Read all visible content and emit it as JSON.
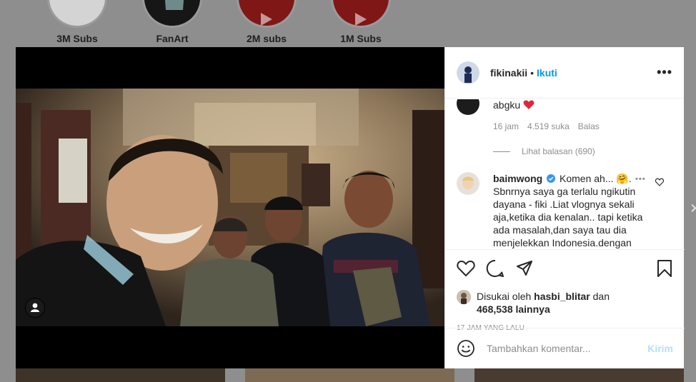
{
  "highlights": [
    {
      "label": "3M Subs"
    },
    {
      "label": "FanArt"
    },
    {
      "label": "2M subs"
    },
    {
      "label": "1M Subs"
    }
  ],
  "post": {
    "username": "fikinakii",
    "follow_label": "Ikuti",
    "more_icon": "more-options-icon"
  },
  "comments": {
    "top": {
      "text": "abgku",
      "time": "16 jam",
      "likes": "4.519 suka",
      "reply_label": "Balas",
      "view_replies": "Lihat balasan (690)"
    },
    "second": {
      "username": "baimwong",
      "verified": true,
      "text": "Komen ah... 🤗. Sbnrnya saya ga terlalu ngikutin dayana - fiki .Liat vlognya sekali aja,ketika dia kenalan.. tapi ketika ada masalah,dan saya tau dia menjelekkan Indonesia.dengan"
    }
  },
  "likes": {
    "prefix": "Disukai oleh",
    "user": "hasbi_blitar",
    "joiner": "dan",
    "count": "468,538 lainnya"
  },
  "timeago": "17 JAM YANG LALU",
  "composer": {
    "placeholder": "Tambahkan komentar...",
    "send_label": "Kirim"
  },
  "colors": {
    "accent": "#0095f6",
    "send_disabled": "#b2dffc",
    "heart": "#ed4956",
    "verified": "#3897f0"
  }
}
